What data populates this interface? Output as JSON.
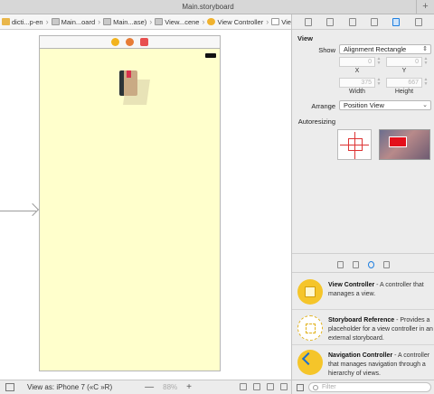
{
  "tabbar": {
    "active_tab": "Main.storyboard",
    "add_symbol": "+"
  },
  "jumpbar": {
    "crumbs": [
      {
        "label": "dicti...p-en",
        "icon": "folder-icon"
      },
      {
        "label": "Main...oard",
        "icon": "storyboard-file-icon"
      },
      {
        "label": "Main...ase)",
        "icon": "storyboard-file-icon"
      },
      {
        "label": "View...cene",
        "icon": "scene-icon"
      },
      {
        "label": "View Controller",
        "icon": "view-controller-icon"
      },
      {
        "label": "View",
        "icon": "view-icon"
      }
    ]
  },
  "canvas": {
    "scene_background": "#ffffcc",
    "dock_icons": [
      "view-controller-icon",
      "first-responder-icon",
      "exit-icon"
    ]
  },
  "bottombar": {
    "view_as": "View as: iPhone 7 («C »R)",
    "zoom_minus": "—",
    "zoom_value": "88%",
    "zoom_plus": "+"
  },
  "inspector": {
    "section_title": "View",
    "show_label": "Show",
    "show_value": "Alignment Rectangle",
    "x_value": "0",
    "y_value": "0",
    "x_caption": "X",
    "y_caption": "Y",
    "width_value": "375",
    "height_value": "667",
    "width_caption": "Width",
    "height_caption": "Height",
    "arrange_label": "Arrange",
    "arrange_value": "Position View",
    "autoresizing_label": "Autoresizing"
  },
  "library": {
    "items": [
      {
        "title": "View Controller",
        "desc": " - A controller that manages a view."
      },
      {
        "title": "Storyboard Reference",
        "desc": " - Provides a placeholder for a view controller in an external storyboard."
      },
      {
        "title": "Navigation Controller",
        "desc": " - A controller that manages navigation through a hierarchy of views."
      }
    ],
    "filter_placeholder": "Filter"
  }
}
